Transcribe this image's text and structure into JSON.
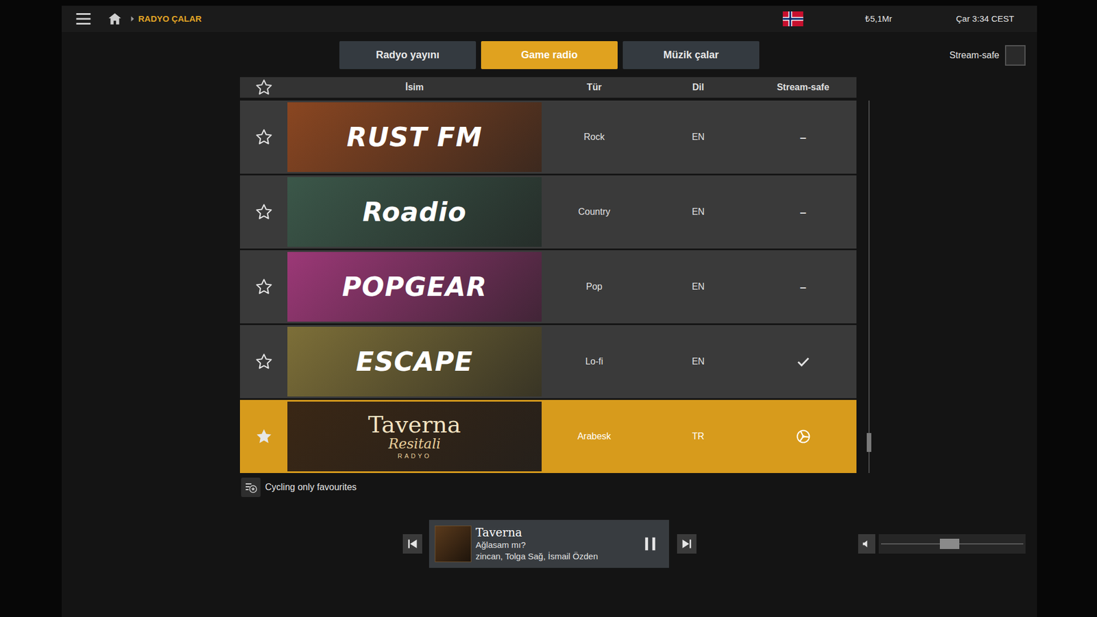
{
  "breadcrumb": {
    "page": "RADYO ÇALAR"
  },
  "status": {
    "money": "₺5,1Mr",
    "clock": "Çar 3:34 CEST"
  },
  "tabs": [
    {
      "label": "Radyo yayını",
      "selected": false
    },
    {
      "label": "Game radio",
      "selected": true
    },
    {
      "label": "Müzik çalar",
      "selected": false
    }
  ],
  "stream_safe_filter": {
    "label": "Stream-safe",
    "checked": false
  },
  "table": {
    "columns": [
      "İsim",
      "Tür",
      "Dil",
      "Stream-safe"
    ],
    "rows": [
      {
        "name": "RUST FM",
        "genre": "Rock",
        "language": "EN",
        "stream_safe": {
          "kind": "dash",
          "text": "–"
        },
        "favourite": false,
        "selected": false,
        "color": "#8a4621"
      },
      {
        "name": "Roadio",
        "genre": "Country",
        "language": "EN",
        "stream_safe": {
          "kind": "dash",
          "text": "–"
        },
        "favourite": false,
        "selected": false,
        "color": "#3b5749"
      },
      {
        "name": "POPGEAR",
        "genre": "Pop",
        "language": "EN",
        "stream_safe": {
          "kind": "dash",
          "text": "–"
        },
        "favourite": false,
        "selected": false,
        "color": "#9c3877"
      },
      {
        "name": "ESCAPE",
        "genre": "Lo-fi",
        "language": "EN",
        "stream_safe": {
          "kind": "check"
        },
        "favourite": false,
        "selected": false,
        "color": "#7d6f38"
      },
      {
        "name": "Taverna",
        "subtitle": "Resitali",
        "tag": "RADYO",
        "genre": "Arabesk",
        "language": "TR",
        "stream_safe": {
          "kind": "special"
        },
        "favourite": true,
        "selected": true,
        "color": "#3a2715"
      }
    ]
  },
  "scrollbar": {
    "level": 0.94
  },
  "cycling": {
    "label": "Cycling only favourites"
  },
  "player": {
    "station": "Taverna",
    "song": "Ağlasam mı?",
    "artists": "zincan, Tolga Sağ, İsmail Özden",
    "playing": true
  },
  "volume": {
    "level": 0.48,
    "muted": false
  }
}
